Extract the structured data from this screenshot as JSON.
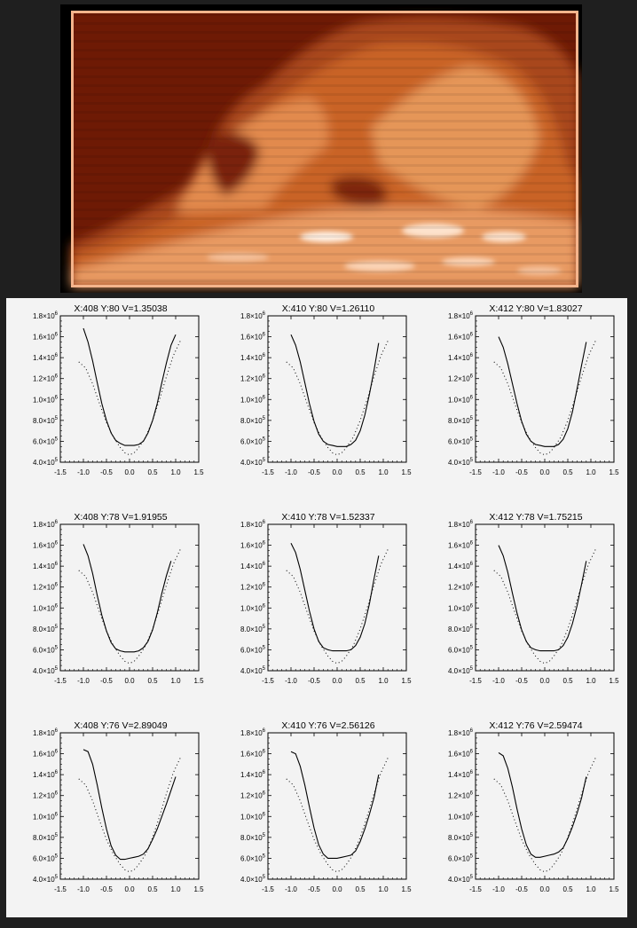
{
  "image": {
    "colors": {
      "frame": "#000000",
      "border": "#f4b48c",
      "dark": "#6e1a05",
      "mid": "#c05a22",
      "bright": "#f2ad80",
      "highlight": "#fff1e4"
    }
  },
  "chart_data": {
    "type": "line",
    "layout": "3x3 grid",
    "shared": {
      "xlim": [
        -1.5,
        1.5
      ],
      "ylim": [
        400000,
        1800000
      ],
      "xticks": [
        "-1.5",
        "-1.0",
        "-0.5",
        "0.0",
        "0.5",
        "1.0",
        "1.5"
      ],
      "yticks": [
        {
          "mant": "4.0",
          "exp": "5"
        },
        {
          "mant": "6.0",
          "exp": "5"
        },
        {
          "mant": "8.0",
          "exp": "5"
        },
        {
          "mant": "1.0",
          "exp": "6"
        },
        {
          "mant": "1.2",
          "exp": "6"
        },
        {
          "mant": "1.4",
          "exp": "6"
        },
        {
          "mant": "1.6",
          "exp": "6"
        },
        {
          "mant": "1.8",
          "exp": "6"
        }
      ],
      "reference_profile": {
        "style": "dotted",
        "x": [
          -1.1,
          -0.95,
          -0.8,
          -0.65,
          -0.5,
          -0.35,
          -0.2,
          -0.1,
          0.0,
          0.1,
          0.2,
          0.35,
          0.5,
          0.65,
          0.8,
          0.95,
          1.1
        ],
        "y": [
          1360000,
          1300000,
          1150000,
          960000,
          780000,
          640000,
          540000,
          490000,
          470000,
          490000,
          540000,
          640000,
          800000,
          1000000,
          1220000,
          1420000,
          1560000
        ]
      }
    },
    "panels": [
      {
        "title": "X:408   Y:80 V=1.35038",
        "x": [
          -1.0,
          -0.9,
          -0.8,
          -0.7,
          -0.6,
          -0.5,
          -0.4,
          -0.3,
          -0.2,
          -0.1,
          0.0,
          0.1,
          0.2,
          0.3,
          0.4,
          0.5,
          0.6,
          0.7,
          0.8,
          0.9,
          1.0
        ],
        "y": [
          1680000,
          1550000,
          1370000,
          1160000,
          960000,
          800000,
          680000,
          610000,
          580000,
          560000,
          560000,
          560000,
          570000,
          600000,
          680000,
          800000,
          960000,
          1160000,
          1350000,
          1520000,
          1620000
        ]
      },
      {
        "title": "X:410   Y:80 V=1.26110",
        "x": [
          -1.0,
          -0.9,
          -0.8,
          -0.7,
          -0.6,
          -0.5,
          -0.4,
          -0.3,
          -0.2,
          -0.1,
          0.0,
          0.1,
          0.2,
          0.3,
          0.4,
          0.5,
          0.6,
          0.7,
          0.8,
          0.9
        ],
        "y": [
          1620000,
          1520000,
          1360000,
          1160000,
          960000,
          790000,
          670000,
          600000,
          570000,
          560000,
          550000,
          550000,
          550000,
          570000,
          610000,
          700000,
          850000,
          1050000,
          1280000,
          1540000
        ]
      },
      {
        "title": "X:412   Y:80 V=1.83027",
        "x": [
          -1.0,
          -0.9,
          -0.8,
          -0.7,
          -0.6,
          -0.5,
          -0.4,
          -0.3,
          -0.2,
          -0.1,
          0.0,
          0.1,
          0.2,
          0.3,
          0.4,
          0.5,
          0.6,
          0.7,
          0.8,
          0.9
        ],
        "y": [
          1600000,
          1500000,
          1340000,
          1150000,
          960000,
          790000,
          670000,
          600000,
          570000,
          560000,
          550000,
          550000,
          550000,
          570000,
          620000,
          720000,
          880000,
          1100000,
          1330000,
          1550000
        ]
      },
      {
        "title": "X:408   Y:78 V=1.91955",
        "x": [
          -1.0,
          -0.9,
          -0.8,
          -0.7,
          -0.6,
          -0.5,
          -0.4,
          -0.3,
          -0.2,
          -0.1,
          0.0,
          0.1,
          0.2,
          0.3,
          0.4,
          0.5,
          0.6,
          0.7,
          0.8,
          0.9
        ],
        "y": [
          1610000,
          1500000,
          1330000,
          1120000,
          930000,
          780000,
          670000,
          610000,
          590000,
          580000,
          580000,
          580000,
          590000,
          620000,
          680000,
          790000,
          950000,
          1140000,
          1310000,
          1450000
        ]
      },
      {
        "title": "X:410   Y:78 V=1.52337",
        "x": [
          -1.0,
          -0.9,
          -0.8,
          -0.7,
          -0.6,
          -0.5,
          -0.4,
          -0.3,
          -0.2,
          -0.1,
          0.0,
          0.1,
          0.2,
          0.3,
          0.4,
          0.5,
          0.6,
          0.7,
          0.8,
          0.9
        ],
        "y": [
          1620000,
          1530000,
          1370000,
          1170000,
          970000,
          800000,
          680000,
          620000,
          600000,
          590000,
          590000,
          590000,
          590000,
          600000,
          640000,
          720000,
          850000,
          1040000,
          1280000,
          1500000
        ]
      },
      {
        "title": "X:412   Y:78 V=1.75215",
        "x": [
          -1.0,
          -0.9,
          -0.8,
          -0.7,
          -0.6,
          -0.5,
          -0.4,
          -0.3,
          -0.2,
          -0.1,
          0.0,
          0.1,
          0.2,
          0.3,
          0.4,
          0.5,
          0.6,
          0.7,
          0.8,
          0.9
        ],
        "y": [
          1600000,
          1500000,
          1340000,
          1140000,
          950000,
          790000,
          680000,
          620000,
          600000,
          590000,
          590000,
          590000,
          590000,
          600000,
          640000,
          720000,
          850000,
          1020000,
          1230000,
          1450000
        ]
      },
      {
        "title": "X:408   Y:76 V=2.89049",
        "x": [
          -1.0,
          -0.9,
          -0.8,
          -0.7,
          -0.6,
          -0.5,
          -0.4,
          -0.3,
          -0.2,
          -0.1,
          0.0,
          0.1,
          0.2,
          0.3,
          0.4,
          0.5,
          0.6,
          0.7,
          0.8,
          0.9,
          1.0
        ],
        "y": [
          1640000,
          1620000,
          1500000,
          1300000,
          1080000,
          880000,
          720000,
          630000,
          590000,
          590000,
          600000,
          610000,
          620000,
          640000,
          690000,
          780000,
          880000,
          1000000,
          1120000,
          1250000,
          1380000
        ]
      },
      {
        "title": "X:410   Y:76 V=2.56126",
        "x": [
          -1.0,
          -0.9,
          -0.8,
          -0.7,
          -0.6,
          -0.5,
          -0.4,
          -0.3,
          -0.2,
          -0.1,
          0.0,
          0.1,
          0.2,
          0.3,
          0.4,
          0.5,
          0.6,
          0.7,
          0.8,
          0.9
        ],
        "y": [
          1620000,
          1600000,
          1480000,
          1300000,
          1090000,
          890000,
          730000,
          640000,
          600000,
          600000,
          600000,
          610000,
          620000,
          630000,
          670000,
          760000,
          880000,
          1020000,
          1180000,
          1400000
        ]
      },
      {
        "title": "X:412   Y:76 V=2.59474",
        "x": [
          -1.0,
          -0.9,
          -0.8,
          -0.7,
          -0.6,
          -0.5,
          -0.4,
          -0.3,
          -0.2,
          -0.1,
          0.0,
          0.1,
          0.2,
          0.3,
          0.4,
          0.5,
          0.6,
          0.7,
          0.8,
          0.9
        ],
        "y": [
          1610000,
          1580000,
          1460000,
          1280000,
          1070000,
          880000,
          730000,
          640000,
          610000,
          610000,
          620000,
          630000,
          640000,
          660000,
          700000,
          790000,
          900000,
          1030000,
          1180000,
          1380000
        ]
      }
    ]
  }
}
